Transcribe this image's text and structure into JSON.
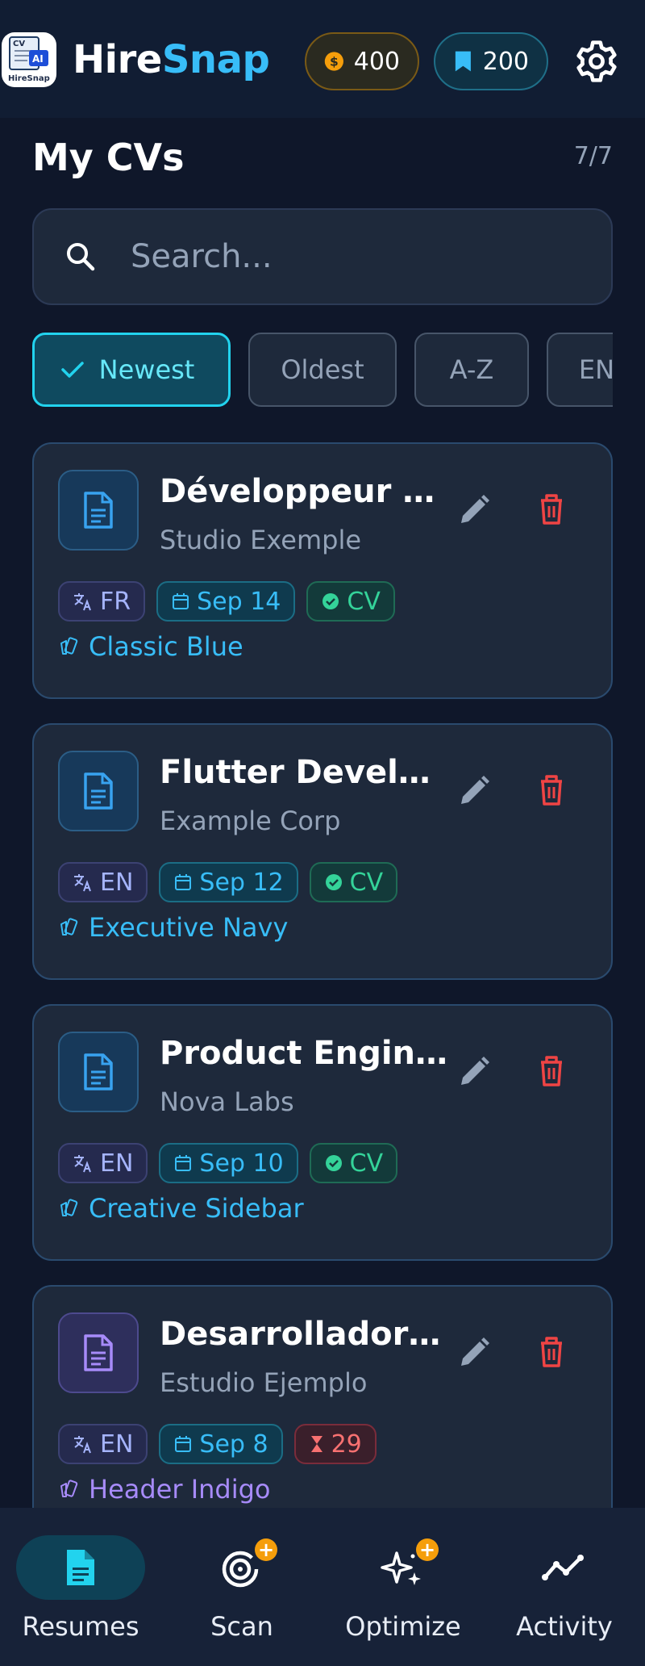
{
  "header": {
    "app_name_part1": "Hire",
    "app_name_part2": "Snap",
    "logo_text_top": "CV",
    "logo_text_ai": "AI",
    "logo_text_bottom": "HireSnap",
    "coins": "400",
    "tokens": "200",
    "icons": {
      "coins": "coin-icon",
      "tokens": "bookmark-icon",
      "settings": "gear-icon"
    },
    "colors": {
      "brand_accent": "#38bdf8",
      "coin": "#f59e0b"
    }
  },
  "page": {
    "title": "My CVs",
    "count": "7/7"
  },
  "search": {
    "placeholder": "Search..."
  },
  "filters": [
    {
      "label": "Newest",
      "active": true
    },
    {
      "label": "Oldest",
      "active": false
    },
    {
      "label": "A-Z",
      "active": false
    },
    {
      "label": "EN",
      "active": false
    }
  ],
  "cvs": [
    {
      "title": "Développeur Fl...",
      "company": "Studio Exemple",
      "lang": "FR",
      "date": "Sep 14",
      "status": "CV",
      "template": "Classic Blue"
    },
    {
      "title": "Flutter Developer",
      "company": "Example Corp",
      "lang": "EN",
      "date": "Sep 12",
      "status": "CV",
      "template": "Executive Navy"
    },
    {
      "title": "Product Engineer",
      "company": "Nova Labs",
      "lang": "EN",
      "date": "Sep 10",
      "status": "CV",
      "template": "Creative Sidebar"
    },
    {
      "title": "Desarrolladora ...",
      "company": "Estudio Ejemplo",
      "lang": "EN",
      "date": "Sep 8",
      "status": "29",
      "template": "Header Indigo"
    }
  ],
  "nav": [
    {
      "label": "Resumes",
      "icon": "document-icon",
      "active": true
    },
    {
      "label": "Scan",
      "icon": "target-icon",
      "badge": "+"
    },
    {
      "label": "Optimize",
      "icon": "sparkle-icon",
      "badge": "+"
    },
    {
      "label": "Activity",
      "icon": "activity-icon"
    }
  ]
}
